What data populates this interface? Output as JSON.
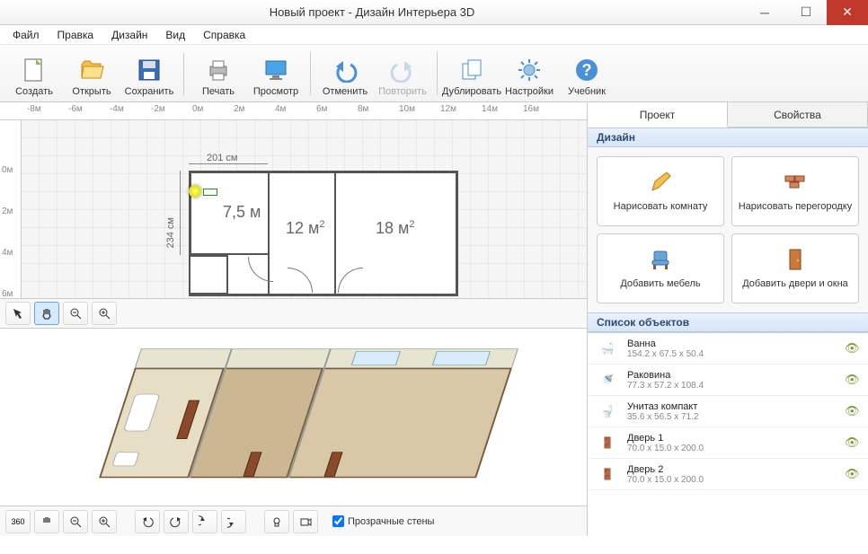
{
  "title": "Новый проект - Дизайн Интерьера 3D",
  "menu": {
    "file": "Файл",
    "edit": "Правка",
    "design": "Дизайн",
    "view": "Вид",
    "help": "Справка"
  },
  "toolbar": {
    "create": "Создать",
    "open": "Открыть",
    "save": "Сохранить",
    "print": "Печать",
    "preview": "Просмотр",
    "undo": "Отменить",
    "redo": "Повторить",
    "duplicate": "Дублировать",
    "settings": "Настройки",
    "manual": "Учебник"
  },
  "ruler_h": [
    "-8м",
    "-6м",
    "-4м",
    "-2м",
    "0м",
    "2м",
    "4м",
    "6м",
    "8м",
    "10м",
    "12м",
    "14м",
    "16м"
  ],
  "ruler_v": [
    "0м",
    "2м",
    "4м",
    "6м"
  ],
  "plan": {
    "dim_w": "201 см",
    "dim_h": "234 см",
    "room1": "7,5 м",
    "room2": "12 м",
    "room2_sup": "2",
    "room3": "18 м",
    "room3_sup": "2"
  },
  "tabs": {
    "project": "Проект",
    "props": "Свойства"
  },
  "section_design": "Дизайн",
  "section_objects": "Список объектов",
  "design_btns": {
    "draw_room": "Нарисовать\nкомнату",
    "draw_wall": "Нарисовать\nперегородку",
    "add_furn": "Добавить\nмебель",
    "add_doors": "Добавить\nдвери и окна"
  },
  "objects": [
    {
      "name": "Ванна",
      "dims": "154.2 x 67.5 x 50.4"
    },
    {
      "name": "Раковина",
      "dims": "77.3 x 57.2 x 108.4"
    },
    {
      "name": "Унитаз компакт",
      "dims": "35.6 x 56.5 x 71.2"
    },
    {
      "name": "Дверь 1",
      "dims": "70.0 x 15.0 x 200.0"
    },
    {
      "name": "Дверь 2",
      "dims": "70.0 x 15.0 x 200.0"
    }
  ],
  "checkbox_walls": "Прозрачные стены"
}
